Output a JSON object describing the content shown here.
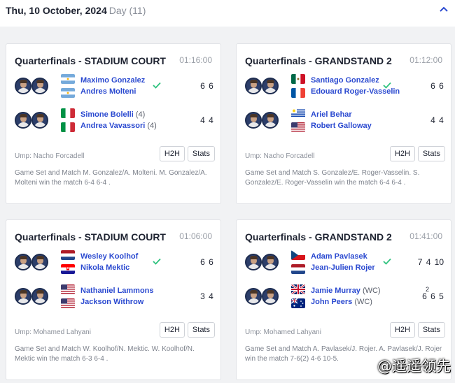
{
  "header": {
    "date": "Thu, 10 October, 2024",
    "day": "Day (11)",
    "collapse_icon": "chevron-up-icon"
  },
  "colors": {
    "accent": "#2b4ad0",
    "winner_check": "#2ec27e",
    "card_bg": "#ffffff",
    "page_bg": "#f1f2f4"
  },
  "matches": [
    {
      "round": "Quarterfinals - STADIUM COURT",
      "time": "01:16:00",
      "teams": [
        {
          "players": [
            "Maximo Gonzalez",
            "Andres Molteni"
          ],
          "seeds": [
            "",
            ""
          ],
          "flags": [
            "flag-argentina",
            "flag-argentina"
          ],
          "winner": true,
          "scores": [
            "6",
            "6"
          ],
          "tiebreaks": [
            "",
            ""
          ]
        },
        {
          "players": [
            "Simone Bolelli",
            "Andrea Vavassori"
          ],
          "seeds": [
            "(4)",
            "(4)"
          ],
          "flags": [
            "flag-italy",
            "flag-italy"
          ],
          "winner": false,
          "scores": [
            "4",
            "4"
          ],
          "tiebreaks": [
            "",
            ""
          ]
        }
      ],
      "umpire": "Ump: Nacho Forcadell",
      "h2h_label": "H2H",
      "stats_label": "Stats",
      "summary": "Game Set and Match M. Gonzalez/A. Molteni. M. Gonzalez/A. Molteni win the match 6-4 6-4 ."
    },
    {
      "round": "Quarterfinals - GRANDSTAND 2",
      "time": "01:12:00",
      "teams": [
        {
          "players": [
            "Santiago Gonzalez",
            "Edouard Roger-Vasselin"
          ],
          "seeds": [
            "",
            ""
          ],
          "flags": [
            "flag-mexico",
            "flag-france"
          ],
          "winner": true,
          "scores": [
            "6",
            "6"
          ],
          "tiebreaks": [
            "",
            ""
          ]
        },
        {
          "players": [
            "Ariel Behar",
            "Robert Galloway"
          ],
          "seeds": [
            "",
            ""
          ],
          "flags": [
            "flag-uruguay",
            "flag-usa"
          ],
          "winner": false,
          "scores": [
            "4",
            "4"
          ],
          "tiebreaks": [
            "",
            ""
          ]
        }
      ],
      "umpire": "Ump: Nacho Forcadell",
      "h2h_label": "H2H",
      "stats_label": "Stats",
      "summary": "Game Set and Match S. Gonzalez/E. Roger-Vasselin. S. Gonzalez/E. Roger-Vasselin win the match 6-4 6-4 ."
    },
    {
      "round": "Quarterfinals - STADIUM COURT",
      "time": "01:06:00",
      "teams": [
        {
          "players": [
            "Wesley Koolhof",
            "Nikola Mektic"
          ],
          "seeds": [
            "",
            ""
          ],
          "flags": [
            "flag-netherlands",
            "flag-croatia"
          ],
          "winner": true,
          "scores": [
            "6",
            "6"
          ],
          "tiebreaks": [
            "",
            ""
          ]
        },
        {
          "players": [
            "Nathaniel Lammons",
            "Jackson Withrow"
          ],
          "seeds": [
            "",
            ""
          ],
          "flags": [
            "flag-usa",
            "flag-usa"
          ],
          "winner": false,
          "scores": [
            "3",
            "4"
          ],
          "tiebreaks": [
            "",
            ""
          ]
        }
      ],
      "umpire": "Ump: Mohamed Lahyani",
      "h2h_label": "H2H",
      "stats_label": "Stats",
      "summary": "Game Set and Match W. Koolhof/N. Mektic. W. Koolhof/N. Mektic win the match 6-3 6-4 ."
    },
    {
      "round": "Quarterfinals - GRANDSTAND 2",
      "time": "01:41:00",
      "teams": [
        {
          "players": [
            "Adam Pavlasek",
            "Jean-Julien Rojer"
          ],
          "seeds": [
            "",
            ""
          ],
          "flags": [
            "flag-czech",
            "flag-netherlands"
          ],
          "winner": true,
          "scores": [
            "7",
            "4",
            "10"
          ],
          "tiebreaks": [
            "",
            "",
            ""
          ]
        },
        {
          "players": [
            "Jamie Murray",
            "John Peers"
          ],
          "seeds": [
            "(WC)",
            "(WC)"
          ],
          "flags": [
            "flag-uk",
            "flag-australia"
          ],
          "winner": false,
          "scores": [
            "6",
            "6",
            "5"
          ],
          "tiebreaks": [
            "2",
            "",
            ""
          ]
        }
      ],
      "umpire": "Ump: Mohamed Lahyani",
      "h2h_label": "H2H",
      "stats_label": "Stats",
      "summary": "Game Set and Match A. Pavlasek/J. Rojer. A. Pavlasek/J. Rojer win the match 7-6(2) 4-6 10-5."
    }
  ],
  "watermark": "@遥遥领先"
}
